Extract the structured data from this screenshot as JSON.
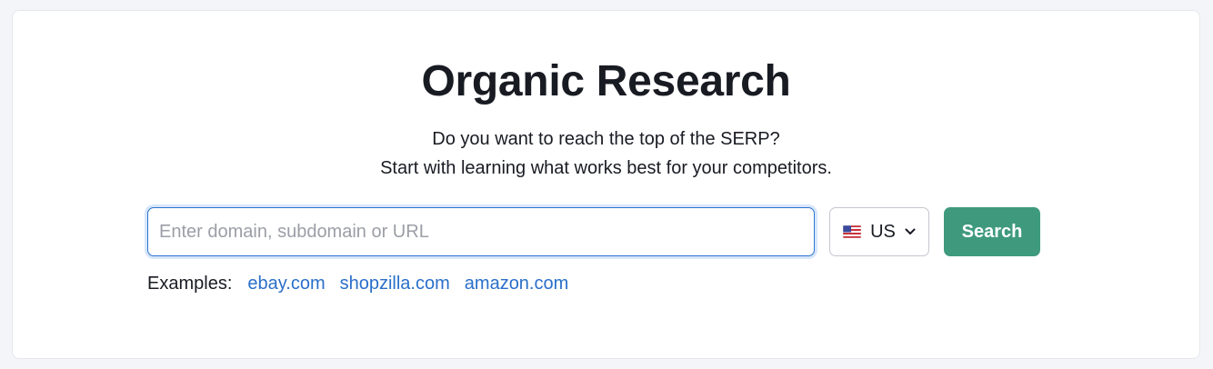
{
  "page": {
    "title": "Organic Research",
    "subtitle_line1": "Do you want to reach the top of the SERP?",
    "subtitle_line2": "Start with learning what works best for your competitors."
  },
  "search": {
    "placeholder": "Enter domain, subdomain or URL",
    "value": "",
    "database": {
      "flag_icon": "us-flag-icon",
      "label": "US",
      "dropdown_icon": "chevron-down-icon"
    },
    "button_label": "Search"
  },
  "examples": {
    "label": "Examples:",
    "links": [
      "ebay.com",
      "shopzilla.com",
      "amazon.com"
    ]
  },
  "colors": {
    "page_background": "#f4f5f9",
    "button_green": "#3f9a7d",
    "link_blue": "#2a6fc9",
    "input_focus_border": "#2d74cf"
  }
}
